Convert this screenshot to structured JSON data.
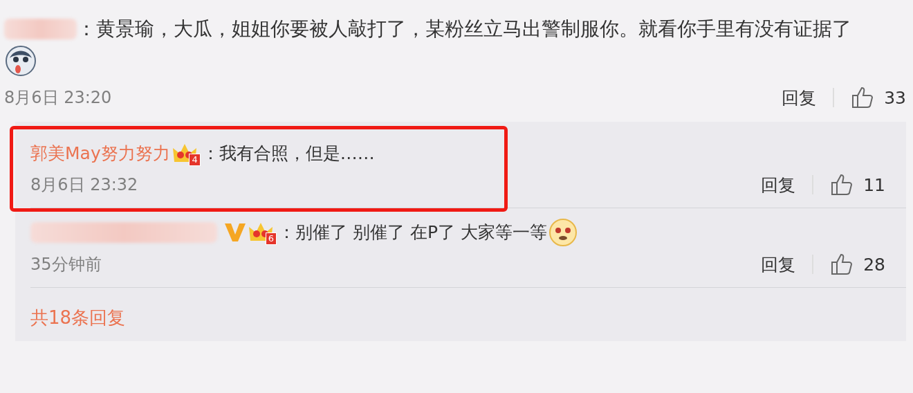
{
  "comment": {
    "separator": "：",
    "text": "黄景瑜，大瓜，姐姐你要被人敲打了，某粉丝立马出警制服你。就看你手里有没有证据了",
    "time": "8月6日 23:20",
    "reply_label": "回复",
    "likes": "33"
  },
  "replies": [
    {
      "name": "郭美May努力努力",
      "name_hidden": false,
      "verified": false,
      "badge": "4",
      "separator": "：",
      "text": "我有合照，但是……",
      "emoji": false,
      "time": "8月6日 23:32",
      "reply_label": "回复",
      "likes": "11",
      "highlighted": true
    },
    {
      "name_hidden": true,
      "verified": true,
      "badge": "6",
      "separator": "：",
      "text": "别催了 别催了 在P了 大家等一等",
      "emoji": true,
      "time": "35分钟前",
      "reply_label": "回复",
      "likes": "28",
      "highlighted": false
    }
  ],
  "more_replies": "共18条回复"
}
